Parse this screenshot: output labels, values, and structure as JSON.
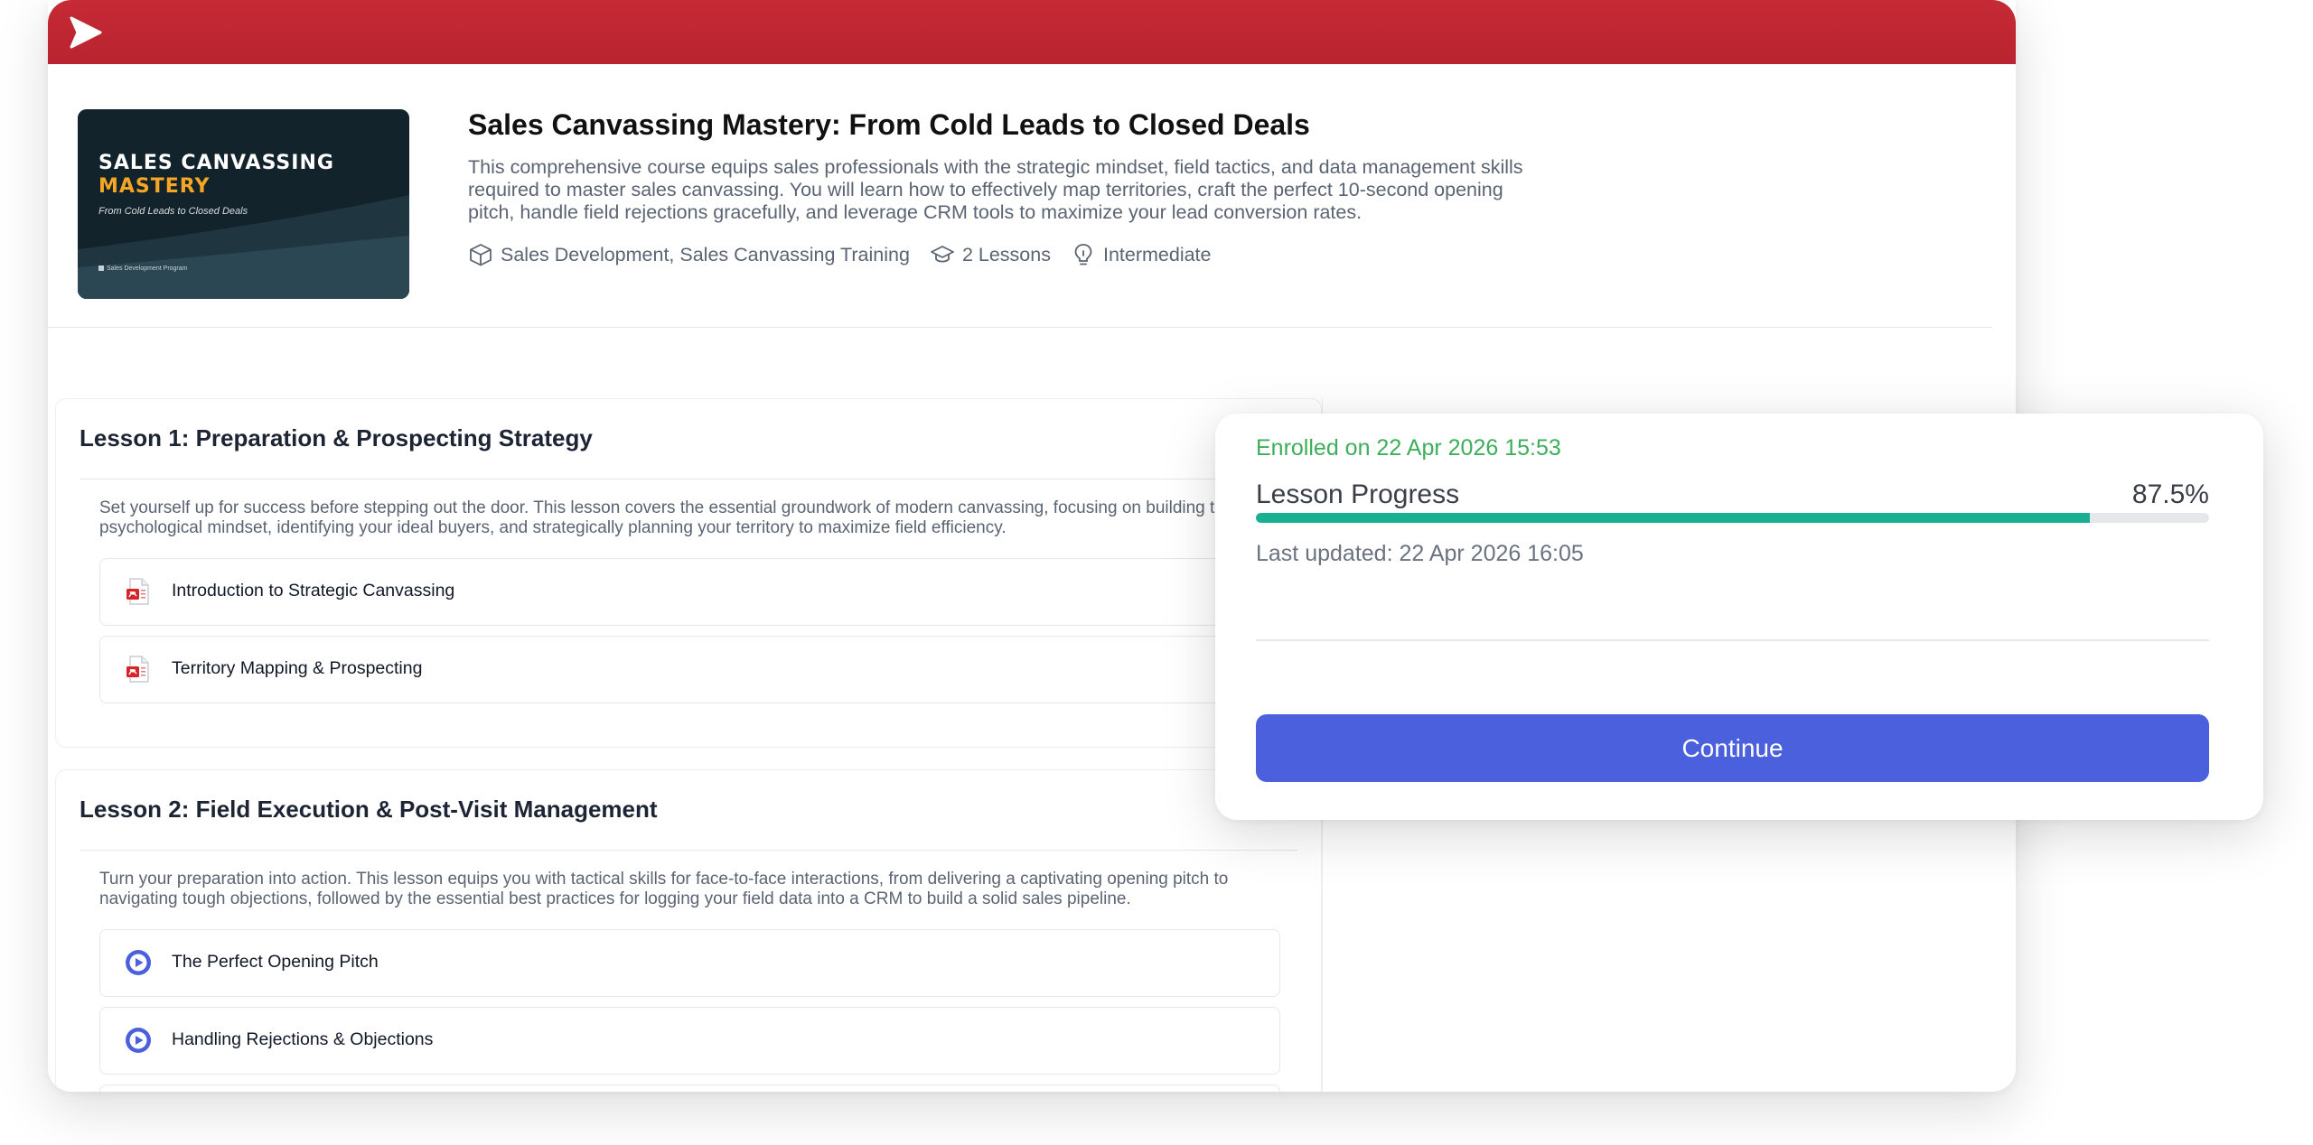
{
  "app": {
    "logo_icon": "play-chevron-icon",
    "brand_color": "#c02833"
  },
  "course": {
    "title": "Sales Canvassing Mastery: From Cold Leads to Closed Deals",
    "description": "This comprehensive course equips sales professionals with the strategic mindset, field tactics, and data management skills required to master sales canvassing. You will learn how to effectively map territories, craft the perfect 10-second opening pitch, handle field rejections gracefully, and leverage CRM tools to maximize your lead conversion rates.",
    "thumbnail": {
      "line1": "SALES CANVASSING",
      "line2": "MASTERY",
      "subtitle": "From Cold Leads to Closed Deals",
      "footer": "Sales Development Program"
    },
    "meta": {
      "categories": "Sales Development, Sales Canvassing Training",
      "lessons": "2 Lessons",
      "level": "Intermediate"
    }
  },
  "lessons": [
    {
      "title": "Lesson 1: Preparation & Prospecting Strategy",
      "description": "Set yourself up for success before stepping out the door. This lesson covers the essential groundwork of modern canvassing, focusing on building the right psychological mindset, identifying your ideal buyers, and strategically planning your territory to maximize field efficiency.",
      "items": [
        {
          "label": "Introduction to Strategic Canvassing",
          "icon": "pdf-file-icon"
        },
        {
          "label": "Territory Mapping & Prospecting",
          "icon": "pdf-file-icon"
        }
      ]
    },
    {
      "title": "Lesson 2: Field Execution & Post-Visit Management",
      "description": "Turn your preparation into action. This lesson equips you with tactical skills for face-to-face interactions, from delivering a captivating opening pitch to navigating tough objections, followed by the essential best practices for logging your field data into a CRM to build a solid sales pipeline.",
      "items": [
        {
          "label": "The Perfect Opening Pitch",
          "icon": "video-play-icon"
        },
        {
          "label": "Handling Rejections & Objections",
          "icon": "video-play-icon"
        }
      ]
    }
  ],
  "progress": {
    "enrolled": "Enrolled on 22 Apr 2026 15:53",
    "label": "Lesson Progress",
    "value_text": "87.5%",
    "value": 87.5,
    "last_updated": "Last updated: 22 Apr 2026 16:05",
    "fill_color": "#19b092",
    "continue_label": "Continue",
    "button_color": "#4b60dd"
  }
}
